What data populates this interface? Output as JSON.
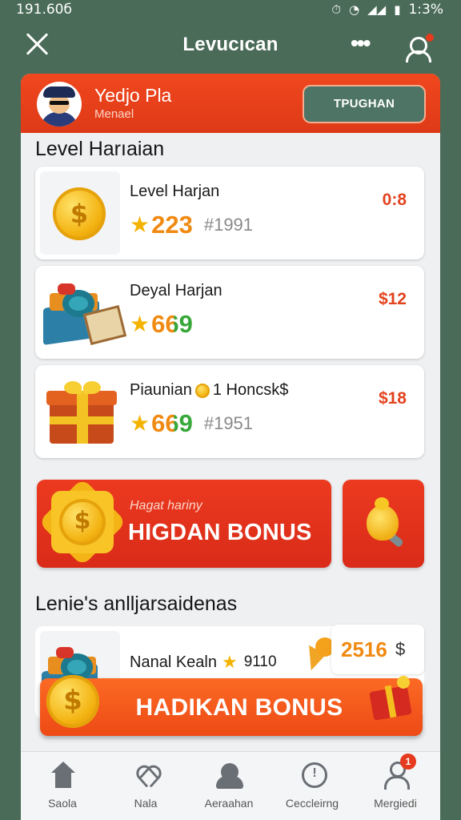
{
  "status_bar": {
    "time": "191.60б",
    "battery": "1:3%"
  },
  "header": {
    "title": "Levucıcan"
  },
  "profile": {
    "name": "Yedjo Pla",
    "subtitle": "Menael",
    "action_label": "ТPUGHAN"
  },
  "daily_section": {
    "title": "Level Harıaian"
  },
  "cards": [
    {
      "title": "Level Harjan",
      "score": "223",
      "rank": "#1991",
      "price": "0:8"
    },
    {
      "title": "Deyal Harjan",
      "score": "669",
      "rank": "",
      "price": "$12"
    },
    {
      "title": "Piaunian",
      "title_extra": "1 Honcsk$",
      "score": "669",
      "rank": "#1951",
      "price": "$18"
    }
  ],
  "promo": {
    "subtitle": "Hagat hariny",
    "label": "HIGDAN BONUS"
  },
  "list_section": {
    "title": "Lenie's anlljarsaidenas"
  },
  "list_item": {
    "name": "Nanal Kealn",
    "count": "9110",
    "amount": "2516",
    "currency": "$"
  },
  "cta": {
    "label": "HADIKAN BONUS"
  },
  "tabs": [
    {
      "label": "Saola",
      "icon": "home-icon"
    },
    {
      "label": "Nala",
      "icon": "heart-icon"
    },
    {
      "label": "Aeraahan",
      "icon": "people-icon"
    },
    {
      "label": "Ceccleirng",
      "icon": "alert-icon"
    },
    {
      "label": "Mergiedi",
      "icon": "user-icon",
      "badge": "1"
    }
  ],
  "colors": {
    "accent": "#e53a1e",
    "background": "#4a6b57",
    "cta": "#f25a1b"
  }
}
